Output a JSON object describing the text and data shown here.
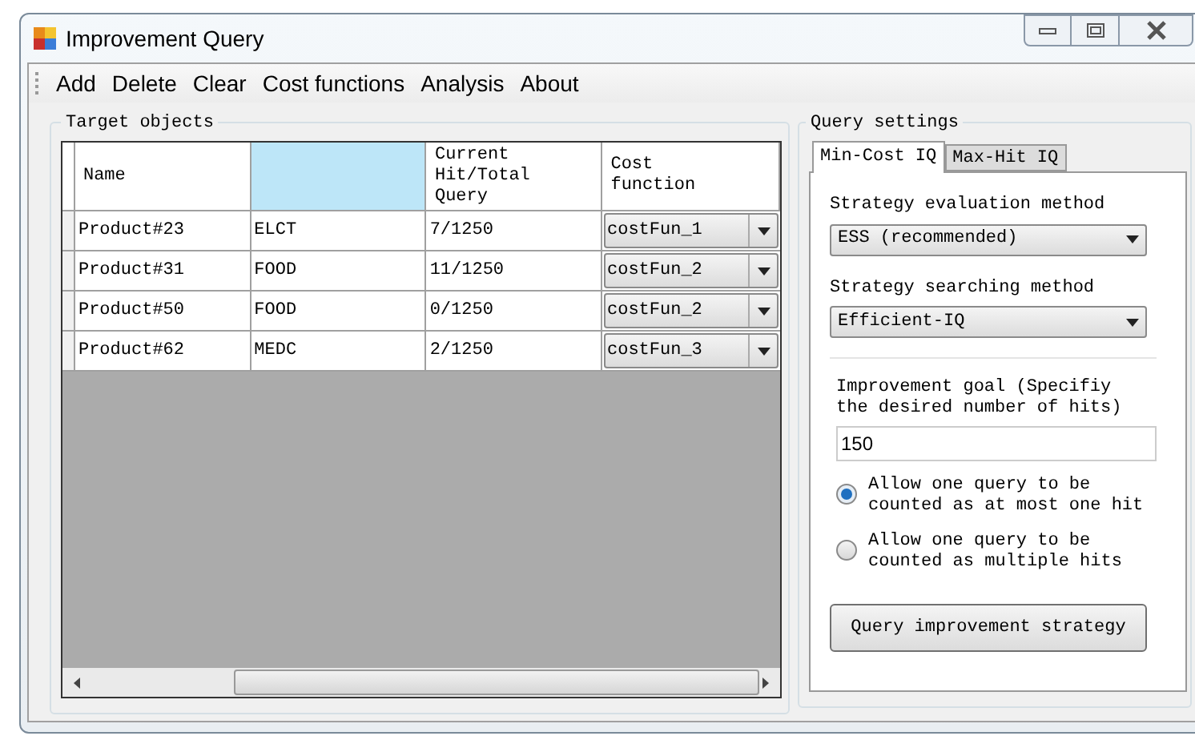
{
  "window": {
    "title": "Improvement Query"
  },
  "menu": [
    "Add",
    "Delete",
    "Clear",
    "Cost functions",
    "Analysis",
    "About"
  ],
  "target_objects": {
    "title": "Target objects",
    "columns": [
      {
        "label": "Name",
        "selected": false
      },
      {
        "selected": true
      },
      {
        "label": "Current Hit/Total Query",
        "selected": false
      },
      {
        "label": "Cost function",
        "selected": false
      }
    ],
    "rows": [
      {
        "cells": [
          "Product#23",
          "ELCT",
          "7/1250"
        ],
        "cost_function": "costFun_1"
      },
      {
        "cells": [
          "Product#31",
          "FOOD",
          "11/1250"
        ],
        "cost_function": "costFun_2"
      },
      {
        "cells": [
          "Product#50",
          "FOOD",
          "0/1250"
        ],
        "cost_function": "costFun_2"
      },
      {
        "cells": [
          "Product#62",
          "MEDC",
          "2/1250"
        ],
        "cost_function": "costFun_3"
      }
    ]
  },
  "query_settings": {
    "title": "Query settings",
    "tabs": [
      {
        "label": "Min-Cost IQ",
        "selected": true
      },
      {
        "label": "Max-Hit IQ",
        "selected": false
      }
    ],
    "evaluation_method": {
      "label": "Strategy evaluation method",
      "value": "ESS (recommended)"
    },
    "searching_method": {
      "label": "Strategy searching method",
      "value": "Efficient-IQ"
    },
    "improvement_goal": {
      "label": "Improvement goal (Specifiy the desired number of hits)",
      "value": "150"
    },
    "radios": [
      {
        "label": "Allow one query to be counted as at most one hit",
        "selected": true
      },
      {
        "label": "Allow one query to be counted as multiple hits",
        "selected": false
      }
    ],
    "button": "Query improvement strategy"
  }
}
